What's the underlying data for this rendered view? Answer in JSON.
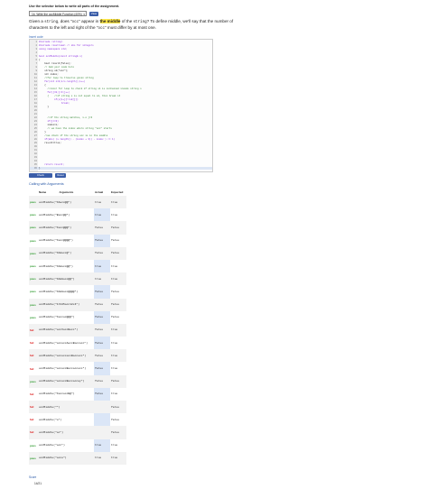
{
  "instructions": "Use the selector below to write all parts of the assignment.",
  "selector": {
    "value": "1b. Write the occMiddle Function (40%)"
  },
  "view_button": "View",
  "prompt": {
    "p1": "Given a ",
    "code1": "string",
    "p2": ", does \"",
    "code2": "occ",
    "p3": "\" appear in ",
    "highlight": "the middle",
    "p4": " of the ",
    "code3": "string",
    "p5": "? To define middle, we'll say that the number of characters to the left and right of the \"",
    "code4": "occ",
    "p6": "\" must differ by at most one."
  },
  "editor_label": "Insert code",
  "code_lines": [
    {
      "n": "1",
      "t": "#include <string>",
      "k": "kw"
    },
    {
      "n": "2",
      "t": "#include <iostream> // obs for integers",
      "k": "kw"
    },
    {
      "n": "3",
      "t": "using namespace std;",
      "k": "kw"
    },
    {
      "n": "4",
      "t": "",
      "k": "plain"
    },
    {
      "n": "5",
      "t": "bool occMiddle(const string& s)",
      "k": "kw"
    },
    {
      "n": "6",
      "t": "{",
      "k": "plain"
    },
    {
      "n": "7",
      "t": "    bool result(false);",
      "k": "plain"
    },
    {
      "n": "8",
      "t": "    // Add your code here",
      "k": "com"
    },
    {
      "n": "9",
      "t": "    string s2(\"occ\");",
      "k": "plain"
    },
    {
      "n": "10",
      "t": "    int index;",
      "k": "plain"
    },
    {
      "n": "11",
      "t": "    //for loop to traverse given string",
      "k": "com"
    },
    {
      "n": "12",
      "t": "    for(int i=0;i<s.length();i++)",
      "k": "kw"
    },
    {
      "n": "13",
      "t": "    {",
      "k": "plain"
    },
    {
      "n": "14",
      "t": "      //inner for loop to check if string s1 is contained inside string s",
      "k": "com"
    },
    {
      "n": "15",
      "t": "      for(j=0;j<3;j++)",
      "k": "kw"
    },
    {
      "n": "16",
      "t": "      {    //if string s is not equal to s2, then break it",
      "k": "com"
    },
    {
      "n": "17",
      "t": "           if(s[i+j]!=s2[j])",
      "k": "kw"
    },
    {
      "n": "18",
      "t": "                break;",
      "k": "kw"
    },
    {
      "n": "19",
      "t": "      }",
      "k": "plain"
    },
    {
      "n": "20",
      "t": "",
      "k": "plain"
    },
    {
      "n": "21",
      "t": "",
      "k": "plain"
    },
    {
      "n": "22",
      "t": "      //if the string matches, i.e j=3",
      "k": "com"
    },
    {
      "n": "23",
      "t": "      if(j==3)",
      "k": "kw"
    },
    {
      "n": "24",
      "t": "      index=i;",
      "k": "plain"
    },
    {
      "n": "25",
      "t": "      // we have the index where string \"occ\" starts",
      "k": "com"
    },
    {
      "n": "26",
      "t": "    }",
      "k": "plain"
    },
    {
      "n": "27",
      "t": "    //we check if the string occ is in the middle",
      "k": "com"
    },
    {
      "n": "28",
      "t": "    if(abs( (s.length() - (index + 3)) - index ) <= 1)",
      "k": "kw"
    },
    {
      "n": "29",
      "t": "    result=true;",
      "k": "plain"
    },
    {
      "n": "30",
      "t": "",
      "k": "plain"
    },
    {
      "n": "31",
      "t": "",
      "k": "plain"
    },
    {
      "n": "32",
      "t": "",
      "k": "plain"
    },
    {
      "n": "33",
      "t": "",
      "k": "plain"
    },
    {
      "n": "34",
      "t": "",
      "k": "plain"
    },
    {
      "n": "35",
      "t": "    return result;",
      "k": "kw"
    },
    {
      "n": "36",
      "t": "}",
      "k": "plain"
    }
  ],
  "buttons": {
    "check": "Check",
    "reset": "Reset"
  },
  "table_label": "Calling with Arguments",
  "table_headers": {
    "name": "Name",
    "args": "Arguments",
    "actual": "Actual",
    "expected": "Expected"
  },
  "rows": [
    {
      "s": "pass",
      "call": "occMiddle(\"XAocc@@\")",
      "act": "true",
      "exp": "true"
    },
    {
      "s": "pass",
      "call": "occMiddle(\"Bocc@@\")",
      "act": "true",
      "exp": "true"
    },
    {
      "s": "pass",
      "call": "occMiddle(\"Xocc@@@\")",
      "act": "false",
      "exp": "false"
    },
    {
      "s": "pass",
      "call": "occMiddle(\"Xocc@@@@\")",
      "act": "false",
      "exp": "false"
    },
    {
      "s": "pass",
      "call": "occMiddle(\"XAAocc@\")",
      "act": "false",
      "exp": "false"
    },
    {
      "s": "pass",
      "call": "occMiddle(\"XAAocc@@\")",
      "act": "true",
      "exp": "true"
    },
    {
      "s": "pass",
      "call": "occMiddle(\"XAAAocc@@\")",
      "act": "true",
      "exp": "true"
    },
    {
      "s": "pass",
      "call": "occMiddle(\"XAAAocc@@@@\")",
      "act": "false",
      "exp": "false"
    },
    {
      "s": "pass",
      "call": "occMiddle(\"1t345occ12x4\")",
      "act": "false",
      "exp": "false"
    },
    {
      "s": "pass",
      "call": "occMiddle(\"Xoccoc@@@\")",
      "act": "false",
      "exp": "false"
    },
    {
      "s": "fail",
      "call": "occMiddle(\"occXoccBocc\")",
      "act": "false",
      "exp": "true"
    },
    {
      "s": "fail",
      "call": "occMiddle(\"occoccAoccBoccocc\")",
      "act": "false",
      "exp": "true"
    },
    {
      "s": "fail",
      "call": "occMiddle(\"occoccoccBoccocc\")",
      "act": "false",
      "exp": "true"
    },
    {
      "s": "fail",
      "call": "occMiddle(\"occoccBoccoccocc\")",
      "act": "false",
      "exp": "true"
    },
    {
      "s": "pass",
      "call": "occMiddle(\"occoccBoccoccay\")",
      "act": "false",
      "exp": "false"
    },
    {
      "s": "fail",
      "call": "occMiddle(\"XoccoccB@\")",
      "act": "false",
      "exp": "true"
    },
    {
      "s": "fail",
      "call": "occMiddle(\"\")",
      "act": "",
      "exp": "false"
    },
    {
      "s": "fail",
      "call": "occMiddle(\"o\")",
      "act": "",
      "exp": "false"
    },
    {
      "s": "fail",
      "call": "occMiddle(\"oc\")",
      "act": "",
      "exp": "false"
    },
    {
      "s": "pass",
      "call": "occMiddle(\"occ\")",
      "act": "true",
      "exp": "true"
    },
    {
      "s": "pass",
      "call": "occMiddle(\"occo\")",
      "act": "true",
      "exp": "true"
    }
  ],
  "status_labels": {
    "pass": "pass",
    "fail": "fail"
  },
  "score_label": "Score",
  "score_value": "14/21"
}
